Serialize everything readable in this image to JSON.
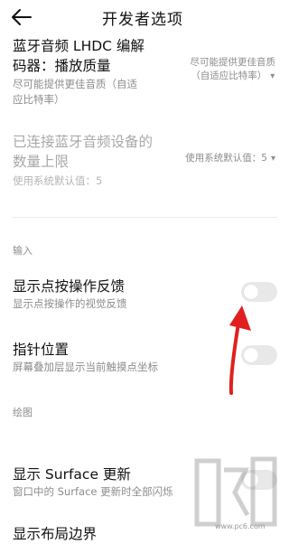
{
  "header": {
    "title": "开发者选项",
    "back_icon": "arrow-left-icon"
  },
  "items": [
    {
      "title": "蓝牙音频 LHDC 编解码器：播放质量",
      "title_line1": "蓝牙音频 LHDC 编解",
      "title_line2": "码器：播放质量",
      "subtitle_line1": "尽可能提供更佳音质（自适",
      "subtitle_line2": "应比特率）",
      "value_line1": "尽可能提供更佳音质",
      "value_line2": "（自适应比特率）",
      "disabled": false
    },
    {
      "title_line1": "已连接蓝牙音频设备的",
      "title_line2": "数量上限",
      "subtitle": "使用系统默认值：5",
      "value": "使用系统默认值：5",
      "disabled": true
    }
  ],
  "sections": {
    "input": "输入",
    "drawing": "绘图"
  },
  "toggles": [
    {
      "title": "显示点按操作反馈",
      "subtitle": "显示点按操作的视觉反馈",
      "enabled": false
    },
    {
      "title": "指针位置",
      "subtitle": "屏幕叠加层显示当前触摸点坐标",
      "enabled": false
    },
    {
      "title": "显示 Surface 更新",
      "subtitle": "窗口中的 Surface 更新时全部闪烁",
      "enabled": false
    }
  ],
  "partial_item": "显示布局边界",
  "watermark": {
    "text": "www.pc6.com"
  },
  "colors": {
    "annotation_arrow": "#e02020",
    "toggle_off": "#e8e8e8"
  }
}
